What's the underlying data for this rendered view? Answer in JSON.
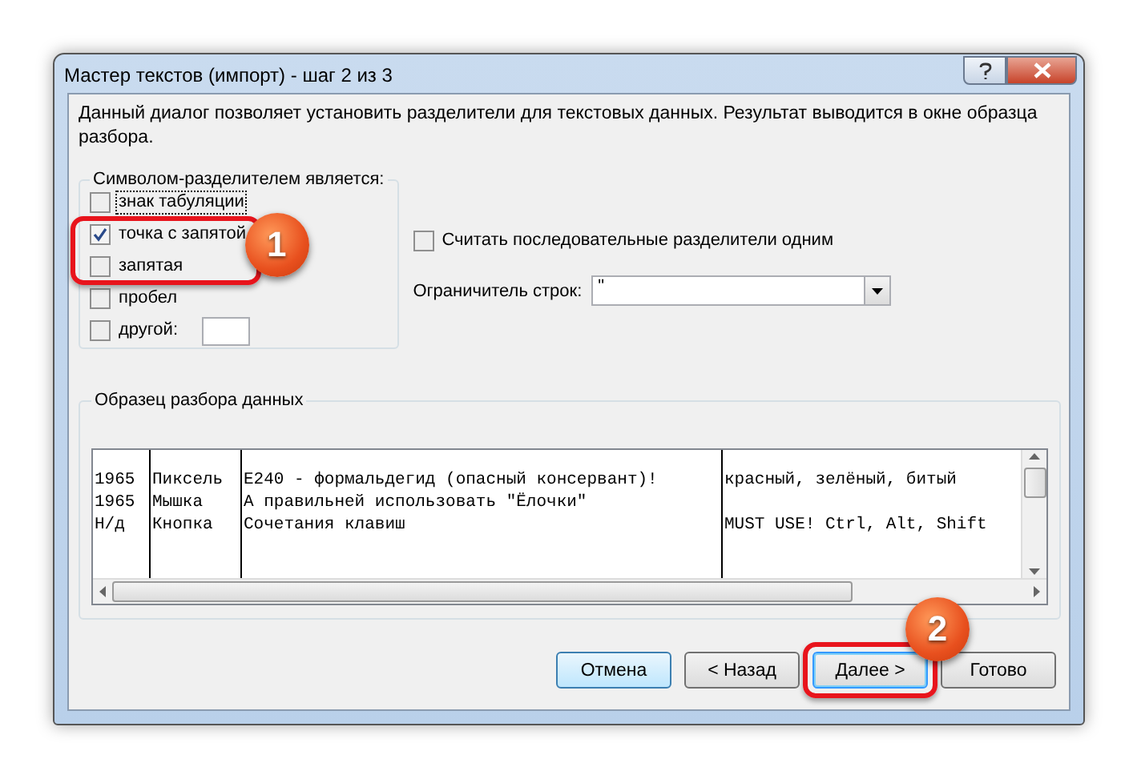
{
  "window": {
    "title": "Мастер текстов (импорт) - шаг 2 из 3"
  },
  "description": "Данный диалог позволяет установить разделители для текстовых данных. Результат выводится в окне образца разбора.",
  "delimiters": {
    "title": "Символом-разделителем является:",
    "annotation": "1",
    "options": [
      {
        "label": "знак табуляции",
        "checked": false,
        "focused": true,
        "highlighted": false
      },
      {
        "label": "точка с запятой",
        "checked": true,
        "focused": false,
        "highlighted": true
      },
      {
        "label": "запятая",
        "checked": false,
        "focused": false,
        "highlighted": true
      },
      {
        "label": "пробел",
        "checked": false,
        "focused": false,
        "highlighted": false
      },
      {
        "label": "другой:",
        "checked": false,
        "focused": false,
        "highlighted": false,
        "kind": "with-field"
      }
    ]
  },
  "consecutive": {
    "label": "Считать последовательные разделители одним",
    "checked": false
  },
  "text_qualifier": {
    "label": "Ограничитель строк:",
    "value": "\""
  },
  "preview": {
    "title": "Образец разбора данных",
    "rows": [
      [
        "1965",
        "Пиксель",
        "E240 - формальдегид (опасный консервант)!",
        "красный, зелёный, битый"
      ],
      [
        "1965",
        "Мышка",
        "А правильней использовать \"Ёлочки\"",
        ""
      ],
      [
        "Н/д",
        "Кнопка",
        "Сочетания клавиш",
        "MUST USE! Ctrl, Alt, Shift"
      ]
    ]
  },
  "buttons": [
    {
      "label": "Отмена",
      "hovered": true,
      "focused": false
    },
    {
      "label": "< Назад",
      "hovered": false,
      "focused": false
    },
    {
      "label": "Далее >",
      "hovered": false,
      "focused": true,
      "annotation": "2"
    },
    {
      "label": "Готово",
      "hovered": false,
      "focused": false
    }
  ]
}
